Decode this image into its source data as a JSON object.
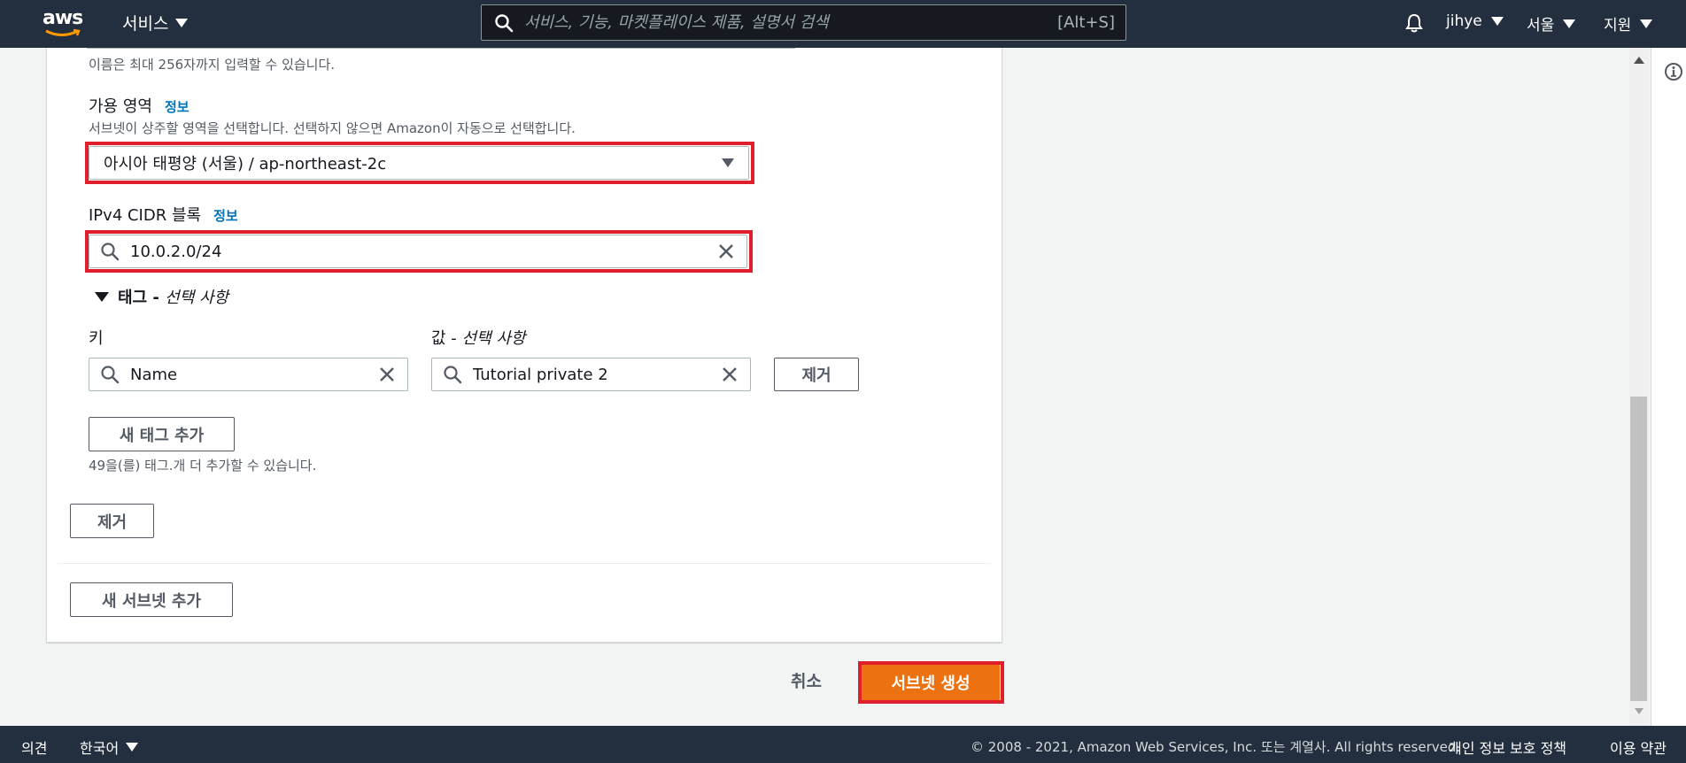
{
  "topnav": {
    "logo": "aws",
    "services_label": "서비스",
    "search_placeholder": "서비스, 기능, 마켓플레이스 제품, 설명서 검색",
    "search_shortcut": "[Alt+S]",
    "user": "jihye",
    "region": "서울",
    "support": "지원"
  },
  "form": {
    "name_hint": "이름은 최대 256자까지 입력할 수 있습니다.",
    "az_label": "가용 영역",
    "az_info": "정보",
    "az_hint": "서브넷이 상주할 영역을 선택합니다. 선택하지 않으면 Amazon이 자동으로 선택합니다.",
    "az_value": "아시아 태평양 (서울) / ap-northeast-2c",
    "cidr_label": "IPv4 CIDR 블록",
    "cidr_info": "정보",
    "cidr_value": "10.0.2.0/24",
    "tags_title": "태그 -",
    "tags_optional": "선택 사항",
    "key_label": "키",
    "value_label": "값 -",
    "value_optional": "선택 사항",
    "key_value": "Name",
    "tag_value": "Tutorial private 2",
    "remove_tag_label": "제거",
    "add_tag_label": "새 태그 추가",
    "tag_limit_hint": "49을(를) 태그.개 더 추가할 수 있습니다.",
    "remove_subnet_label": "제거",
    "add_subnet_label": "새 서브넷 추가"
  },
  "actions": {
    "cancel_label": "취소",
    "create_label": "서브넷 생성"
  },
  "footer": {
    "feedback": "의견",
    "language": "한국어",
    "copyright": "© 2008 - 2021, Amazon Web Services, Inc. 또는 계열사. All rights reserved.",
    "privacy": "개인 정보 보호 정책",
    "terms": "이용 약관"
  },
  "colors": {
    "nav_bg": "#232f3e",
    "primary_orange": "#ec7211",
    "highlight_red": "#df1f2c",
    "link_blue": "#0073bb"
  },
  "icons": [
    "aws-logo",
    "caret-down-icon",
    "search-icon",
    "bell-icon",
    "close-icon",
    "info-icon"
  ]
}
